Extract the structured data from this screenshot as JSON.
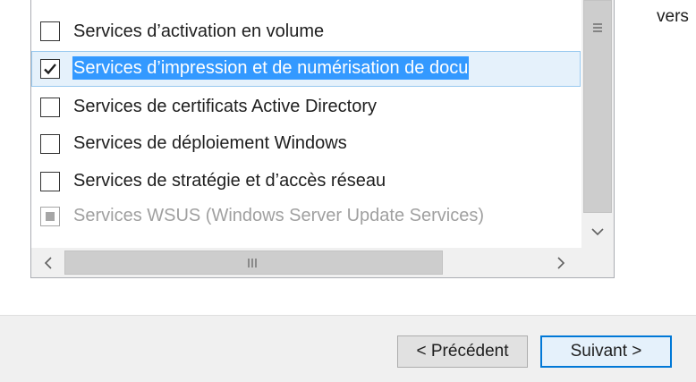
{
  "features": [
    {
      "label": "Services d’activation en volume",
      "checked": false,
      "selected": false,
      "disabled": false
    },
    {
      "label": "Services d’impression et de numérisation de docu",
      "checked": true,
      "selected": true,
      "disabled": false
    },
    {
      "label": "Services de certificats Active Directory",
      "checked": false,
      "selected": false,
      "disabled": false
    },
    {
      "label": "Services de déploiement Windows",
      "checked": false,
      "selected": false,
      "disabled": false
    },
    {
      "label": "Services de stratégie et d’accès réseau",
      "checked": false,
      "selected": false,
      "disabled": false
    },
    {
      "label": "Services WSUS (Windows Server Update Services)",
      "checked": "partial",
      "selected": false,
      "disabled": true
    }
  ],
  "side_text": "vers",
  "buttons": {
    "previous": "< Précédent",
    "next": "Suivant >"
  },
  "icons": {
    "expand": "triangle-right-icon",
    "scroll_left": "chevron-left-icon",
    "scroll_right": "chevron-right-icon",
    "scroll_down": "chevron-down-icon",
    "vthumb_grip": "grip-icon",
    "hthumb_grip": "grip-icon"
  },
  "colors": {
    "selection_bg": "#3399ff",
    "selection_row": "#e5f1fb",
    "next_border": "#0078d7"
  }
}
